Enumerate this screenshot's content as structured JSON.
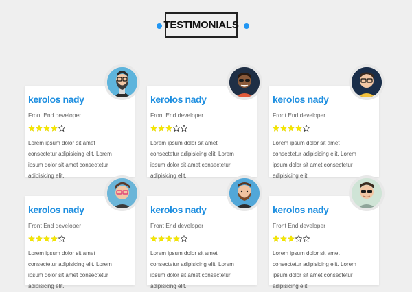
{
  "section_title": "TESTIMONIALS",
  "accent_color": "#2196f3",
  "testimonials": [
    {
      "name": "kerolos nady",
      "role": "Front End developer",
      "rating": 4,
      "text": "Lorem ipsum dolor sit amet consectetur adipisicing elit. Lorem ipsum dolor sit amet consectetur adipisicing elit.",
      "avatar_icon": "avatar-bearded-glasses-icon"
    },
    {
      "name": "kerolos nady",
      "role": "Front End developer",
      "rating": 3,
      "text": "Lorem ipsum dolor sit amet consectetur adipisicing elit. Lorem ipsum dolor sit amet consectetur adipisicing elit.",
      "avatar_icon": "avatar-sunglasses-icon"
    },
    {
      "name": "kerolos nady",
      "role": "Front End developer",
      "rating": 4,
      "text": "Lorem ipsum dolor sit amet consectetur adipisicing elit. Lorem ipsum dolor sit amet consectetur adipisicing elit.",
      "avatar_icon": "avatar-glasses-navy-icon"
    },
    {
      "name": "kerolos nady",
      "role": "Front End developer",
      "rating": 4,
      "text": "Lorem ipsum dolor sit amet consectetur adipisicing elit. Lorem ipsum dolor sit amet consectetur adipisicing elit.",
      "avatar_icon": "avatar-pink-glasses-icon"
    },
    {
      "name": "kerolos nady",
      "role": "Front End developer",
      "rating": 4,
      "text": "Lorem ipsum dolor sit amet consectetur adipisicing elit. Lorem ipsum dolor sit amet consectetur adipisicing elit.",
      "avatar_icon": "avatar-bearded-icon"
    },
    {
      "name": "kerolos nady",
      "role": "Front End developer",
      "rating": 3,
      "text": "Lorem ipsum dolor sit amet consectetur adipisicing elit. Lorem ipsum dolor sit amet consectetur adipisicing elit.",
      "avatar_icon": "avatar-sunglasses-light-icon"
    }
  ]
}
